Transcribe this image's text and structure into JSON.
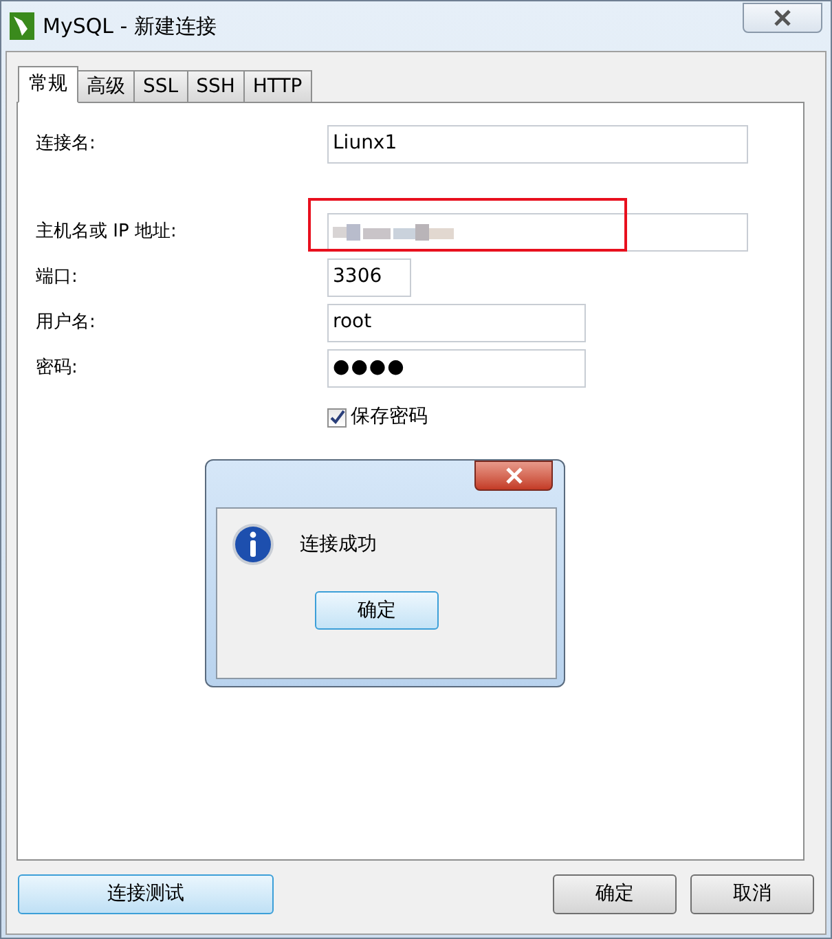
{
  "window": {
    "title": "MySQL - 新建连接"
  },
  "tabs": [
    {
      "label": "常规",
      "selected": true
    },
    {
      "label": "高级",
      "selected": false
    },
    {
      "label": "SSL",
      "selected": false
    },
    {
      "label": "SSH",
      "selected": false
    },
    {
      "label": "HTTP",
      "selected": false
    }
  ],
  "fields": [
    {
      "label": "连接名:",
      "kind": "text",
      "value": "Liunx1"
    },
    {
      "label": "主机名或 IP 地址:",
      "kind": "obscured",
      "highlighted": true
    },
    {
      "label": "端口:",
      "kind": "text",
      "value": "3306"
    },
    {
      "label": "用户名:",
      "kind": "text",
      "value": "root"
    },
    {
      "label": "密码:",
      "kind": "password",
      "value": "●●●●"
    }
  ],
  "save_password": {
    "label": "保存密码",
    "checked": true
  },
  "message_box": {
    "message": "连接成功",
    "button": "确定"
  },
  "buttons": [
    {
      "label": "连接测试",
      "kind": "default"
    },
    {
      "label": "确定",
      "kind": "normal"
    },
    {
      "label": "取消",
      "kind": "normal"
    }
  ]
}
